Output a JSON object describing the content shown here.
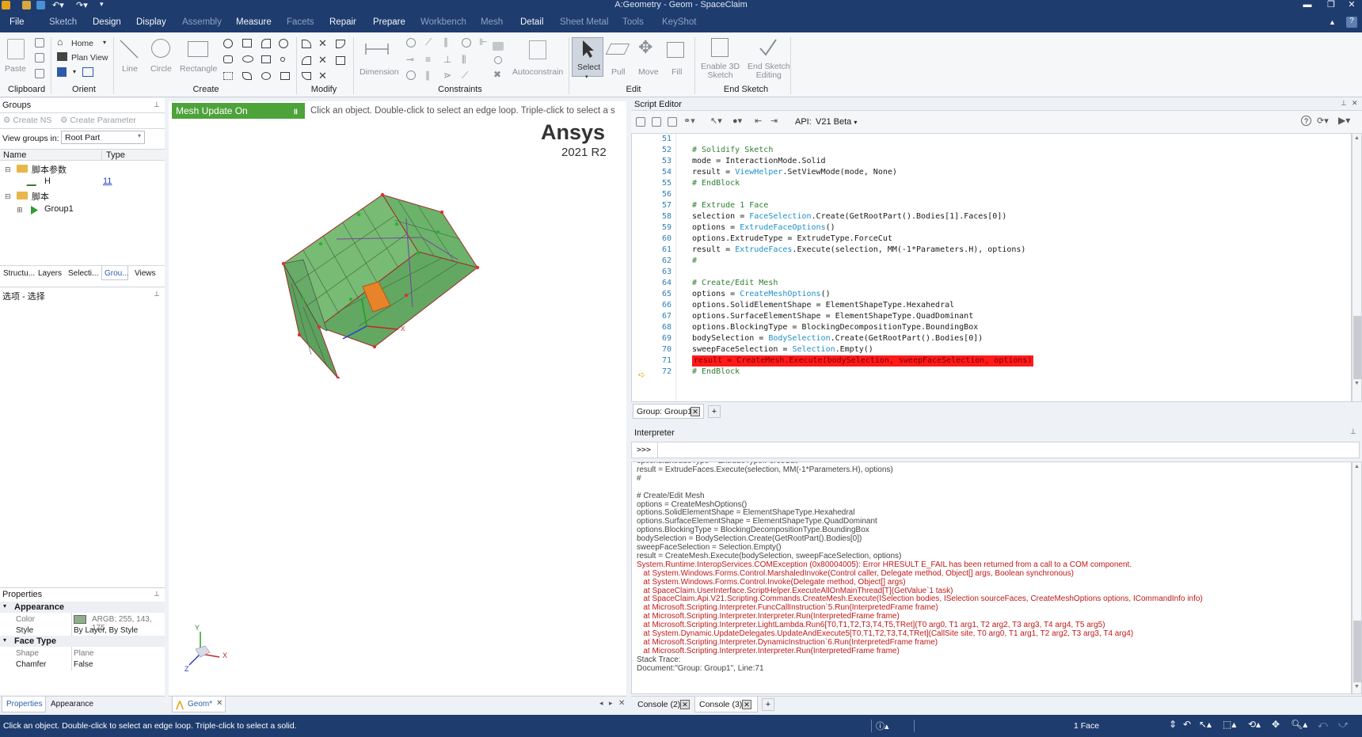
{
  "window": {
    "title": "A:Geometry - Geom - SpaceClaim"
  },
  "menu": {
    "file": "File",
    "tabs": [
      "Sketch",
      "Design",
      "Display",
      "Assembly",
      "Measure",
      "Facets",
      "Repair",
      "Prepare",
      "Workbench",
      "Mesh",
      "Detail",
      "Sheet Metal",
      "Tools",
      "KeyShot"
    ]
  },
  "ribbon": {
    "clipboard": {
      "label": "Clipboard",
      "paste": "Paste"
    },
    "orient": {
      "label": "Orient",
      "home": "Home",
      "plan_view": "Plan View"
    },
    "create": {
      "label": "Create",
      "line": "Line",
      "circle": "Circle",
      "rectangle": "Rectangle"
    },
    "modify": {
      "label": "Modify"
    },
    "constraints": {
      "label": "Constraints",
      "dimension": "Dimension",
      "autoconstrain": "Autoconstrain"
    },
    "edit": {
      "label": "Edit",
      "select": "Select",
      "pull": "Pull",
      "move": "Move",
      "fill": "Fill"
    },
    "end_sketch": {
      "label": "End Sketch",
      "enable_3d_l1": "Enable 3D",
      "enable_3d_l2": "Sketch",
      "end_editing_l1": "End Sketch",
      "end_editing_l2": "Editing"
    }
  },
  "groups_panel": {
    "title": "Groups",
    "create_ns": "Create NS",
    "create_parameter": "Create Parameter",
    "view_groups_in_label": "View groups in:",
    "view_groups_in_value": "Root Part",
    "col_name": "Name",
    "col_type": "Type",
    "tree": [
      {
        "label": "脚本参数",
        "type": ""
      },
      {
        "label": "H",
        "type": "11"
      },
      {
        "label": "脚本",
        "type": ""
      },
      {
        "label": "Group1",
        "type": ""
      }
    ],
    "tabs": [
      "Structu...",
      "Layers",
      "Selecti...",
      "Grou...",
      "Views"
    ]
  },
  "options_panel": {
    "title": "选项 - 选择"
  },
  "properties_panel": {
    "title": "Properties",
    "sections": [
      {
        "name": "Appearance",
        "rows": [
          {
            "k": "Color",
            "v": "ARGB: 255, 143, 175"
          },
          {
            "k": "Style",
            "v": "By Layer, By Style"
          }
        ]
      },
      {
        "name": "Face Type",
        "rows": [
          {
            "k": "Shape",
            "v": "Plane"
          },
          {
            "k": "Chamfer",
            "v": "False"
          }
        ]
      }
    ],
    "tabs": [
      "Properties",
      "Appearance"
    ],
    "swatch_color": "#8faf8a"
  },
  "viewport": {
    "mesh_update": "Mesh Update On",
    "hint": "Click an object. Double-click to select an edge loop. Triple-click to select a s",
    "brand": "Ansys",
    "version": "2021 R2",
    "axis_x": "X",
    "axis_y": "Y",
    "axis_z": "Z",
    "doc_tab": "Geom*"
  },
  "script_editor": {
    "title": "Script Editor",
    "api_label": "API:",
    "api_value": "V21 Beta",
    "lines": [
      {
        "n": "51",
        "t": ""
      },
      {
        "n": "52",
        "t": "# Solidify Sketch",
        "c": "cm"
      },
      {
        "n": "53",
        "t": "mode = InteractionMode.Solid"
      },
      {
        "n": "54",
        "a": "result = ",
        "k": "ViewHelper",
        "b": ".SetViewMode(mode, None)"
      },
      {
        "n": "55",
        "t": "# EndBlock",
        "c": "cm"
      },
      {
        "n": "56",
        "t": ""
      },
      {
        "n": "57",
        "t": "# Extrude 1 Face",
        "c": "cm"
      },
      {
        "n": "58",
        "a": "selection = ",
        "k": "FaceSelection",
        "b": ".Create(GetRootPart().Bodies[1].Faces[0])"
      },
      {
        "n": "59",
        "a": "options = ",
        "k": "ExtrudeFaceOptions",
        "b": "()"
      },
      {
        "n": "60",
        "t": "options.ExtrudeType = ExtrudeType.ForceCut"
      },
      {
        "n": "61",
        "a": "result = ",
        "k": "ExtrudeFaces",
        "b": ".Execute(selection, MM(-1*Parameters.H), options)"
      },
      {
        "n": "62",
        "t": "#",
        "c": "cm"
      },
      {
        "n": "63",
        "t": ""
      },
      {
        "n": "64",
        "t": "# Create/Edit Mesh",
        "c": "cm"
      },
      {
        "n": "65",
        "a": "options = ",
        "k": "CreateMeshOptions",
        "b": "()"
      },
      {
        "n": "66",
        "t": "options.SolidElementShape = ElementShapeType.Hexahedral"
      },
      {
        "n": "67",
        "t": "options.SurfaceElementShape = ElementShapeType.QuadDominant"
      },
      {
        "n": "68",
        "t": "options.BlockingType = BlockingDecompositionType.BoundingBox"
      },
      {
        "n": "69",
        "a": "bodySelection = ",
        "k": "BodySelection",
        "b": ".Create(GetRootPart().Bodies[0])"
      },
      {
        "n": "70",
        "a": "sweepFaceSelection = ",
        "k": "Selection",
        "b": ".Empty()"
      },
      {
        "n": "71",
        "t": "result = CreateMesh.Execute(bodySelection, sweepFaceSelection, options)",
        "hl": true
      },
      {
        "n": "72",
        "t": "# EndBlock",
        "c": "cm"
      }
    ],
    "group_tab": "Group: Group1"
  },
  "interpreter": {
    "title": "Interpreter",
    "prompt": ">>>",
    "lines": [
      {
        "t": "options.ExtrudeType = ExtrudeType.ForceCut"
      },
      {
        "t": "result = ExtrudeFaces.Execute(selection, MM(-1*Parameters.H), options)"
      },
      {
        "t": "#"
      },
      {
        "t": ""
      },
      {
        "t": "# Create/Edit Mesh"
      },
      {
        "t": "options = CreateMeshOptions()"
      },
      {
        "t": "options.SolidElementShape = ElementShapeType.Hexahedral"
      },
      {
        "t": "options.SurfaceElementShape = ElementShapeType.QuadDominant"
      },
      {
        "t": "options.BlockingType = BlockingDecompositionType.BoundingBox"
      },
      {
        "t": "bodySelection = BodySelection.Create(GetRootPart().Bodies[0])"
      },
      {
        "t": "sweepFaceSelection = Selection.Empty()"
      },
      {
        "t": "result = CreateMesh.Execute(bodySelection, sweepFaceSelection, options)"
      },
      {
        "t": "System.Runtime.InteropServices.COMException (0x80004005): Error HRESULT E_FAIL has been returned from a call to a COM component.",
        "e": true
      },
      {
        "t": "   at System.Windows.Forms.Control.MarshaledInvoke(Control caller, Delegate method, Object[] args, Boolean synchronous)",
        "e": true
      },
      {
        "t": "   at System.Windows.Forms.Control.Invoke(Delegate method, Object[] args)",
        "e": true
      },
      {
        "t": "   at SpaceClaim.UserInterface.ScriptHelper.ExecuteAllOnMainThread[T](GetValue`1 task)",
        "e": true
      },
      {
        "t": "   at SpaceClaim.Api.V21.Scripting.Commands.CreateMesh.Execute(ISelection bodies, ISelection sourceFaces, CreateMeshOptions options, ICommandInfo info)",
        "e": true
      },
      {
        "t": "   at Microsoft.Scripting.Interpreter.FuncCallInstruction`5.Run(InterpretedFrame frame)",
        "e": true
      },
      {
        "t": "   at Microsoft.Scripting.Interpreter.Interpreter.Run(InterpretedFrame frame)",
        "e": true
      },
      {
        "t": "   at Microsoft.Scripting.Interpreter.LightLambda.Run6[T0,T1,T2,T3,T4,T5,TRet](T0 arg0, T1 arg1, T2 arg2, T3 arg3, T4 arg4, T5 arg5)",
        "e": true
      },
      {
        "t": "   at System.Dynamic.UpdateDelegates.UpdateAndExecute5[T0,T1,T2,T3,T4,TRet](CallSite site, T0 arg0, T1 arg1, T2 arg2, T3 arg3, T4 arg4)",
        "e": true
      },
      {
        "t": "   at Microsoft.Scripting.Interpreter.DynamicInstruction`6.Run(InterpretedFrame frame)",
        "e": true
      },
      {
        "t": "   at Microsoft.Scripting.Interpreter.Interpreter.Run(InterpretedFrame frame)",
        "e": true
      },
      {
        "t": "Stack Trace:"
      },
      {
        "t": "Document:\"Group: Group1\", Line:71"
      }
    ],
    "console_tabs": [
      "Console (2)",
      "Console (3)"
    ]
  },
  "statusbar": {
    "message": "Click an object. Double-click to select an edge loop. Triple-click to select a solid.",
    "selection": "1 Face"
  },
  "colors": {
    "accent": "#1e3c6e",
    "mesh_green": "#6bb36b",
    "mesh_highlight": "#e8832a",
    "error": "#c21818",
    "highlight_red": "#ff1a1a"
  }
}
